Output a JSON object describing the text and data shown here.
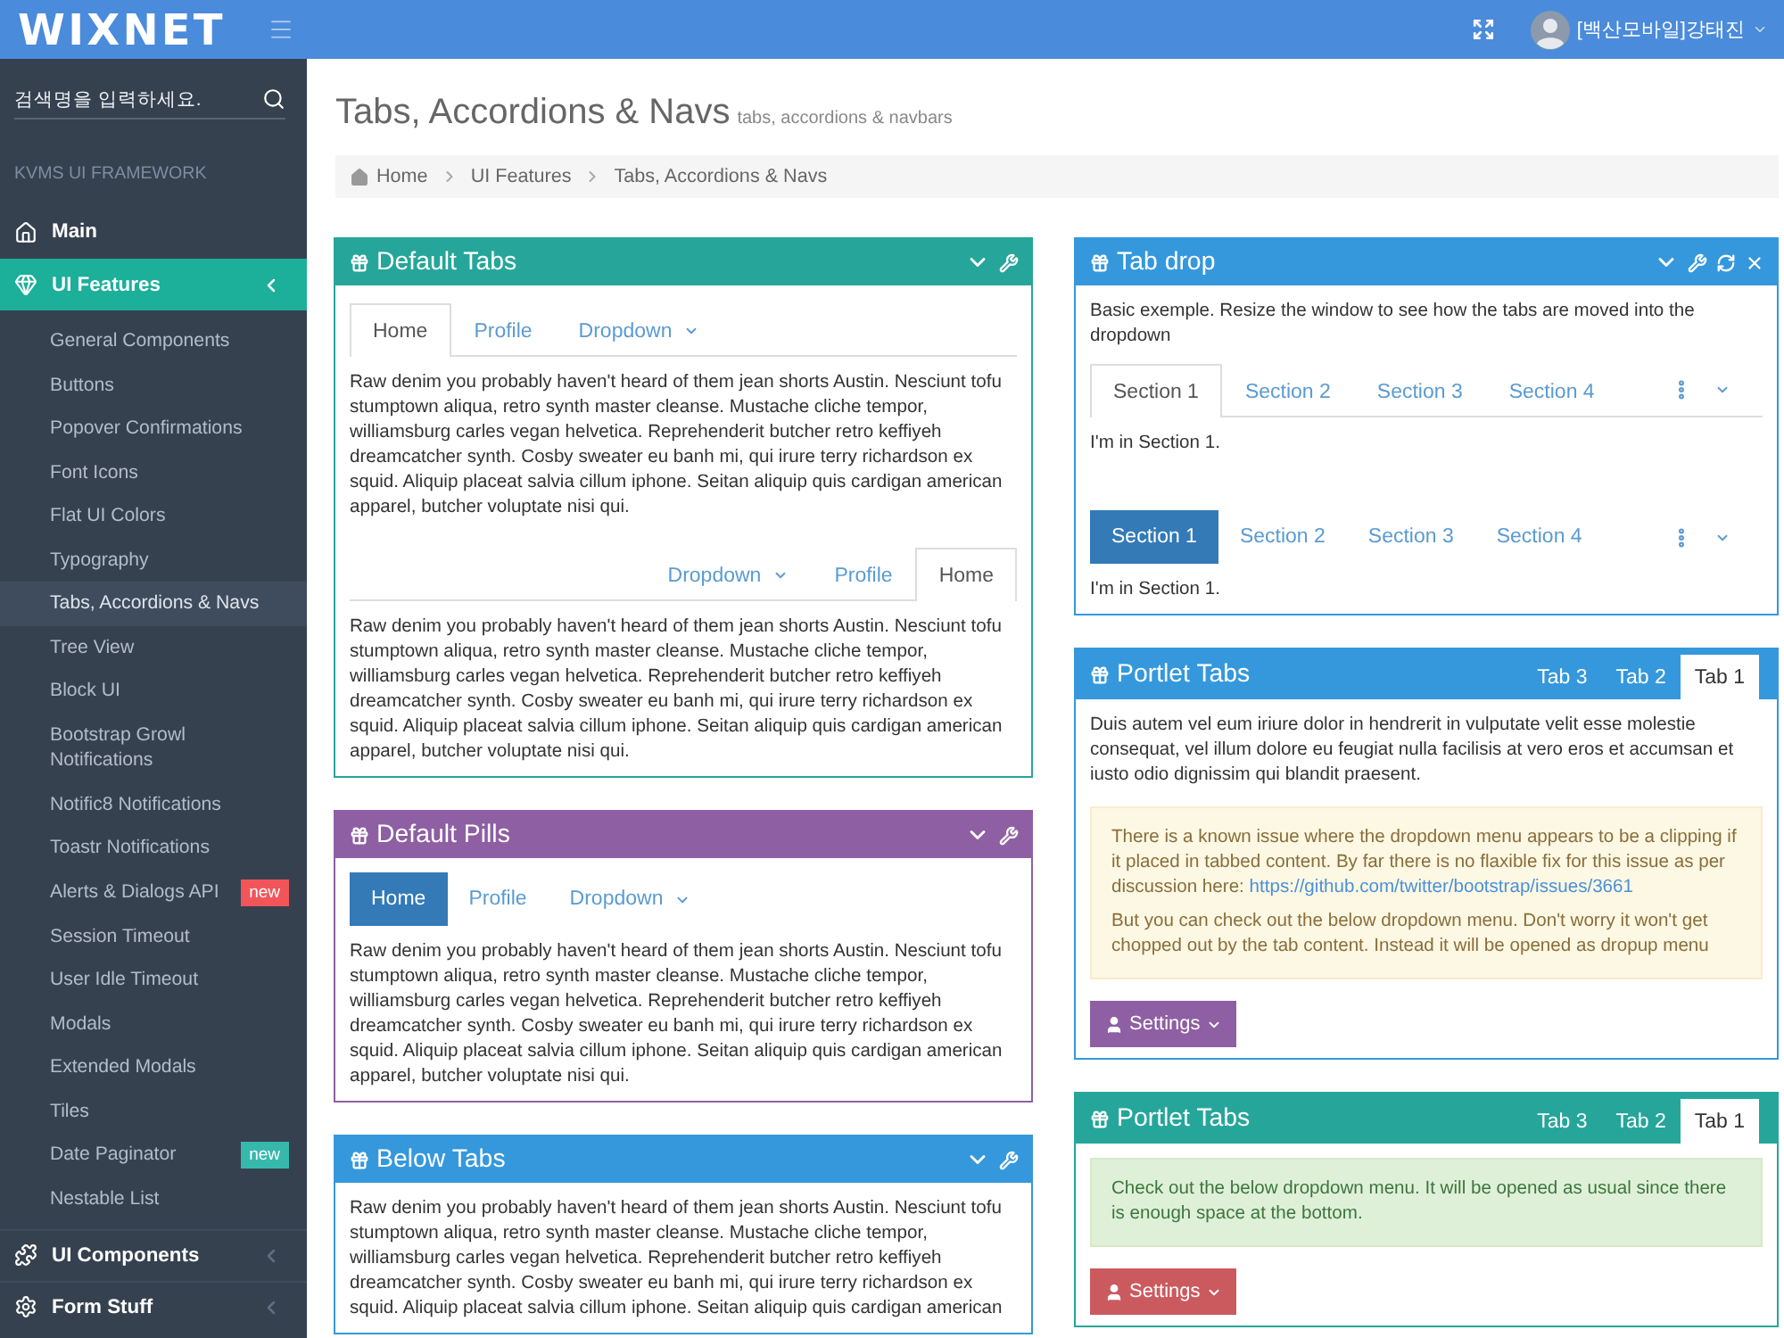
{
  "topbar": {
    "logo": "WIXNET",
    "user": "[백산모바일]강태진"
  },
  "sidebar": {
    "search": {
      "placeholder": "검색명을 입력하세요."
    },
    "heading": "KVMS UI FRAMEWORK",
    "items": [
      {
        "label": "Main",
        "kind": "link",
        "selected": false
      },
      {
        "label": "UI Features",
        "kind": "group",
        "selected": true,
        "children": [
          {
            "label": "General Components",
            "selected": false
          },
          {
            "label": "Buttons",
            "selected": false
          },
          {
            "label": "Popover Confirmations",
            "selected": false
          },
          {
            "label": "Font Icons",
            "selected": false
          },
          {
            "label": "Flat UI Colors",
            "selected": false
          },
          {
            "label": "Typography",
            "selected": false
          },
          {
            "label": "Tabs, Accordions & Navs",
            "selected": true
          },
          {
            "label": "Tree View",
            "selected": false
          },
          {
            "label": "Block UI",
            "selected": false
          },
          {
            "label": "Bootstrap Growl Notifications",
            "selected": false
          },
          {
            "label": "Notific8 Notifications",
            "selected": false
          },
          {
            "label": "Toastr Notifications",
            "selected": false
          },
          {
            "label": "Alerts & Dialogs API",
            "selected": false,
            "badge": {
              "text": "new",
              "color": "#f1555a"
            }
          },
          {
            "label": "Session Timeout",
            "selected": false
          },
          {
            "label": "User Idle Timeout",
            "selected": false
          },
          {
            "label": "Modals",
            "selected": false
          },
          {
            "label": "Extended Modals",
            "selected": false
          },
          {
            "label": "Tiles",
            "selected": false
          },
          {
            "label": "Date Paginator",
            "selected": false,
            "badge": {
              "text": "new",
              "color": "#36b9ac"
            }
          },
          {
            "label": "Nestable List",
            "selected": false
          }
        ]
      },
      {
        "label": "UI Components",
        "kind": "group",
        "selected": false
      },
      {
        "label": "Form Stuff",
        "kind": "group",
        "selected": false
      }
    ]
  },
  "page_header": {
    "title": "Tabs, Accordions & Navs",
    "subtitle": "tabs, accordions & navbars"
  },
  "breadcrumb": [
    "Home",
    "UI Features",
    "Tabs, Accordions & Navs"
  ],
  "columns": [
    {
      "panels": [
        {
          "title": "Default Tabs",
          "kind": "collapsible",
          "color": "#26a69a",
          "blocks": [
            {
              "kind": "tabs",
              "overflow": false,
              "items": [
                {
                  "label": "Home",
                  "selected": true,
                  "dropdown": false
                },
                {
                  "label": "Profile",
                  "selected": false,
                  "dropdown": false
                },
                {
                  "label": "Dropdown",
                  "selected": false,
                  "dropdown": true
                }
              ]
            },
            {
              "kind": "paragraph",
              "text": "Raw denim you probably haven't heard of them jean shorts Austin. Nesciunt tofu stumptown aliqua, retro synth master cleanse. Mustache cliche tempor, williamsburg carles vegan helvetica. Reprehenderit butcher retro keffiyeh dreamcatcher synth. Cosby sweater eu banh mi, qui irure terry richardson ex squid. Aliquip placeat salvia cillum iphone. Seitan aliquip quis cardigan american apparel, butcher voluptate nisi qui."
            },
            {
              "kind": "right_tabs",
              "overflow": false,
              "items": [
                {
                  "label": "Dropdown",
                  "selected": false,
                  "dropdown": true
                },
                {
                  "label": "Profile",
                  "selected": false,
                  "dropdown": false
                },
                {
                  "label": "Home",
                  "selected": true,
                  "dropdown": false
                }
              ]
            },
            {
              "kind": "paragraph",
              "text": "Raw denim you probably haven't heard of them jean shorts Austin. Nesciunt tofu stumptown aliqua, retro synth master cleanse. Mustache cliche tempor, williamsburg carles vegan helvetica. Reprehenderit butcher retro keffiyeh dreamcatcher synth. Cosby sweater eu banh mi, qui irure terry richardson ex squid. Aliquip placeat salvia cillum iphone. Seitan aliquip quis cardigan american apparel, butcher voluptate nisi qui."
            }
          ]
        },
        {
          "title": "Default Pills",
          "kind": "collapsible",
          "color": "#8e5fa2",
          "blocks": [
            {
              "kind": "pills",
              "overflow": false,
              "items": [
                {
                  "label": "Home",
                  "selected": true,
                  "dropdown": false
                },
                {
                  "label": "Profile",
                  "selected": false,
                  "dropdown": false
                },
                {
                  "label": "Dropdown",
                  "selected": false,
                  "dropdown": true
                }
              ]
            },
            {
              "kind": "paragraph",
              "text": "Raw denim you probably haven't heard of them jean shorts Austin. Nesciunt tofu stumptown aliqua, retro synth master cleanse. Mustache cliche tempor, williamsburg carles vegan helvetica. Reprehenderit butcher retro keffiyeh dreamcatcher synth. Cosby sweater eu banh mi, qui irure terry richardson ex squid. Aliquip placeat salvia cillum iphone. Seitan aliquip quis cardigan american apparel, butcher voluptate nisi qui."
            }
          ]
        },
        {
          "title": "Below Tabs",
          "kind": "collapsible",
          "color": "#3598dc",
          "blocks": [
            {
              "kind": "paragraph",
              "text": "Raw denim you probably haven't heard of them jean shorts Austin. Nesciunt tofu stumptown aliqua, retro synth master cleanse. Mustache cliche tempor, williamsburg carles vegan helvetica. Reprehenderit butcher retro keffiyeh dreamcatcher synth. Cosby sweater eu banh mi, qui irure terry richardson ex squid. Aliquip placeat salvia cillum iphone. Seitan aliquip quis cardigan american"
            }
          ]
        }
      ]
    },
    {
      "panels": [
        {
          "title": "Tab drop",
          "kind": "full",
          "color": "#3598dc",
          "blocks": [
            {
              "kind": "paragraph",
              "text": "Basic exemple. Resize the window to see how the tabs are moved into the dropdown"
            },
            {
              "kind": "tabs",
              "overflow": true,
              "items": [
                {
                  "label": "Section 1",
                  "selected": true,
                  "dropdown": false
                },
                {
                  "label": "Section 2",
                  "selected": false,
                  "dropdown": false
                },
                {
                  "label": "Section 3",
                  "selected": false,
                  "dropdown": false
                },
                {
                  "label": "Section 4",
                  "selected": false,
                  "dropdown": false
                }
              ]
            },
            {
              "kind": "paragraph",
              "text": "I'm in Section 1."
            },
            {
              "kind": "pills",
              "overflow": true,
              "items": [
                {
                  "label": "Section 1",
                  "selected": true,
                  "dropdown": false
                },
                {
                  "label": "Section 2",
                  "selected": false,
                  "dropdown": false
                },
                {
                  "label": "Section 3",
                  "selected": false,
                  "dropdown": false
                },
                {
                  "label": "Section 4",
                  "selected": false,
                  "dropdown": false
                }
              ]
            },
            {
              "kind": "paragraph",
              "text": "I'm in Section 1."
            }
          ]
        },
        {
          "title": "Portlet Tabs",
          "kind": "tabbed",
          "color": "#3598dc",
          "header_tabs": [
            {
              "label": "Tab 3",
              "selected": false
            },
            {
              "label": "Tab 2",
              "selected": false
            },
            {
              "label": "Tab 1",
              "selected": true
            }
          ],
          "blocks": [
            {
              "kind": "paragraph",
              "text": "Duis autem vel eum iriure dolor in hendrerit in vulputate velit esse molestie consequat, vel illum dolore eu feugiat nulla facilisis at vero eros et accumsan et iusto odio dignissim qui blandit praesent."
            },
            {
              "kind": "warning_alert",
              "paragraphs": [
                {
                  "text": "There is a known issue where the dropdown menu appears to be a clipping if it placed in tabbed content. By far there is no flaxible fix for this issue as per discussion here:",
                  "link": "https://github.com/twitter/bootstrap/issues/3661"
                },
                {
                  "text": "But you can check out the below dropdown menu. Don't worry it won't get chopped out by the tab content. Instead it will be opened as dropup menu"
                }
              ]
            },
            {
              "kind": "button",
              "label": "Settings",
              "color": "#8e5fa2"
            }
          ]
        },
        {
          "title": "Portlet Tabs",
          "kind": "tabbed",
          "color": "#26a69a",
          "header_tabs": [
            {
              "label": "Tab 3",
              "selected": false
            },
            {
              "label": "Tab 2",
              "selected": false
            },
            {
              "label": "Tab 1",
              "selected": true
            }
          ],
          "blocks": [
            {
              "kind": "success_alert",
              "paragraphs": [
                {
                  "text": "Check out the below dropdown menu. It will be opened as usual since there is enough space at the bottom."
                }
              ]
            },
            {
              "kind": "button",
              "label": "Settings",
              "color": "#cb5a5e"
            }
          ]
        }
      ]
    }
  ]
}
